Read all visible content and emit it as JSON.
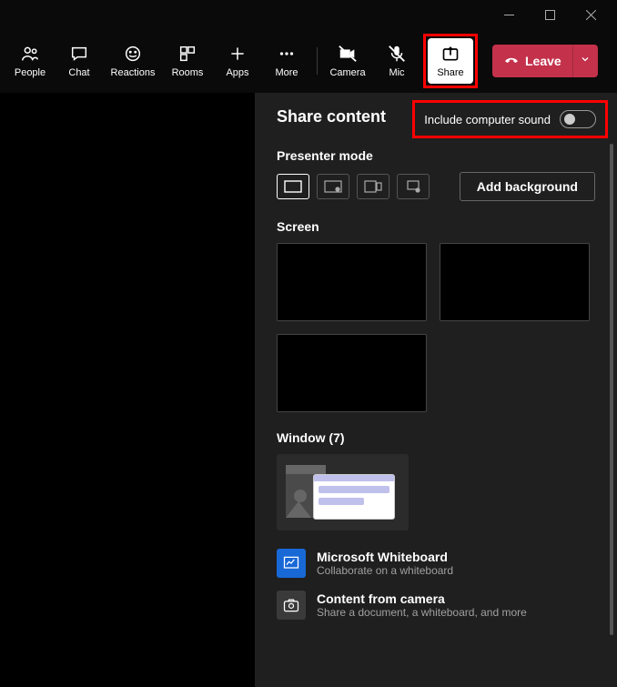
{
  "toolbar": {
    "people": "People",
    "chat": "Chat",
    "reactions": "Reactions",
    "rooms": "Rooms",
    "apps": "Apps",
    "more": "More",
    "camera": "Camera",
    "mic": "Mic",
    "share": "Share",
    "leave": "Leave"
  },
  "panel": {
    "title": "Share content",
    "include_sound": "Include computer sound",
    "presenter_mode": "Presenter mode",
    "add_background": "Add background",
    "screen": "Screen",
    "window": "Window (7)",
    "whiteboard": {
      "title": "Microsoft Whiteboard",
      "sub": "Collaborate on a whiteboard"
    },
    "camera": {
      "title": "Content from camera",
      "sub": "Share a document, a whiteboard, and more"
    }
  }
}
